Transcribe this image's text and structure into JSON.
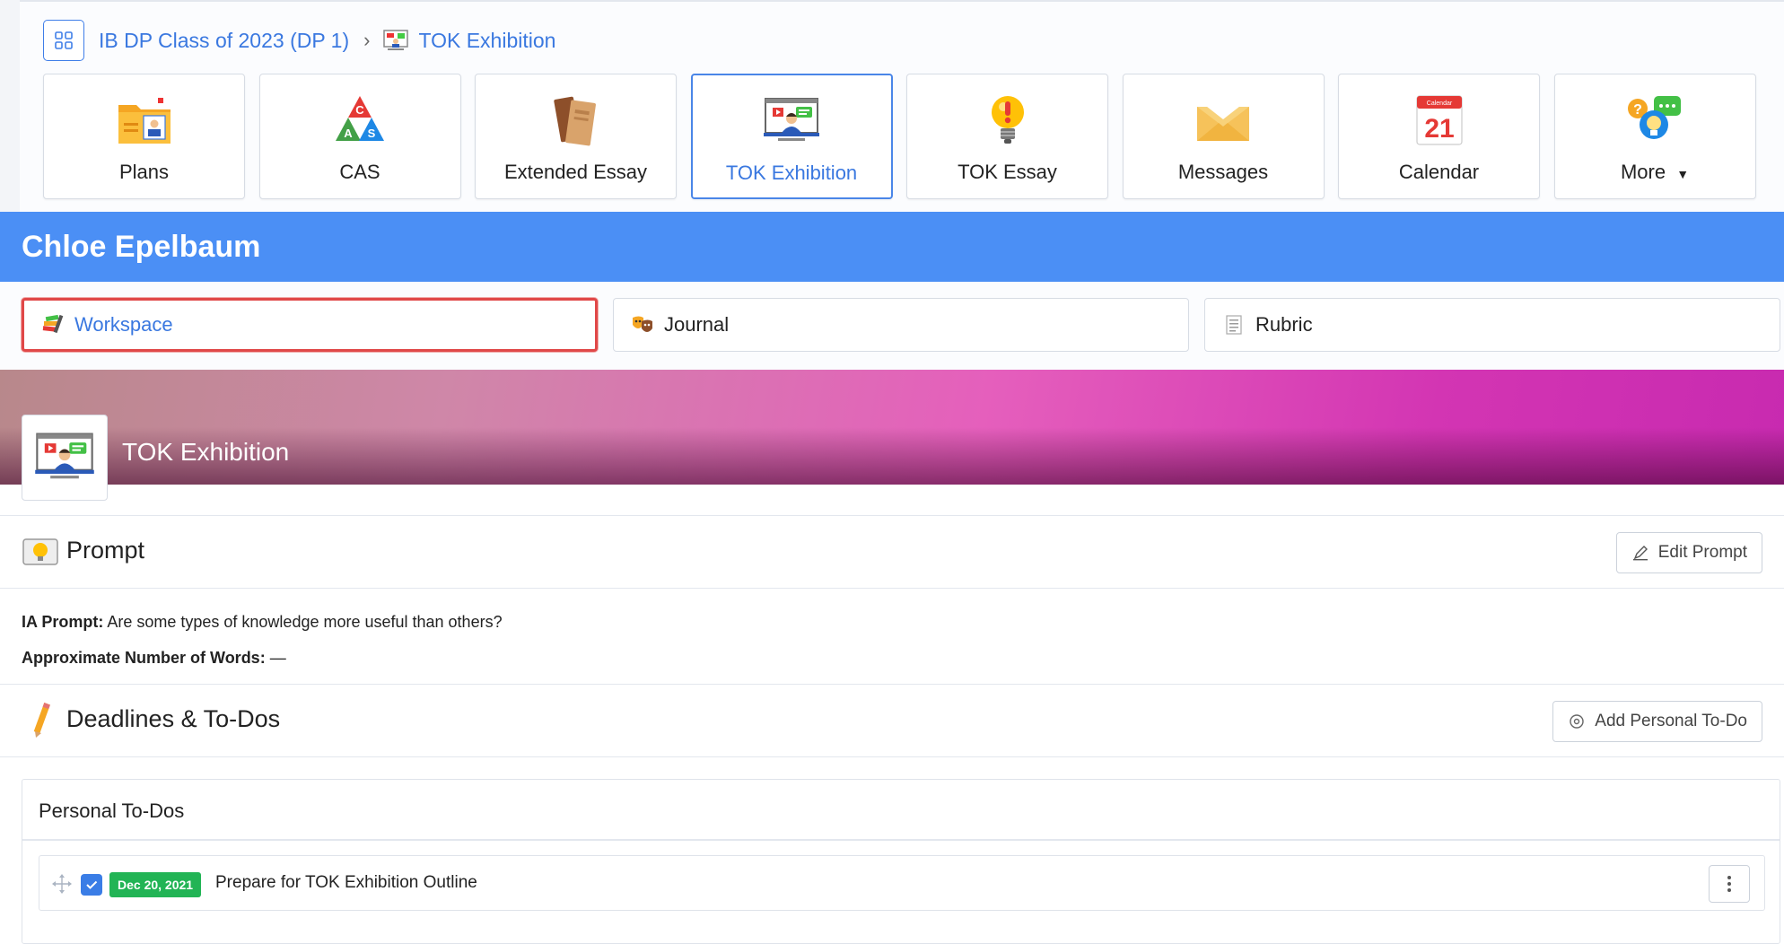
{
  "breadcrumb": {
    "parent": "IB DP Class of 2023 (DP 1)",
    "current": "TOK Exhibition"
  },
  "tiles": [
    {
      "label": "Plans",
      "icon": "plans-folder-icon"
    },
    {
      "label": "CAS",
      "icon": "cas-triangle-icon"
    },
    {
      "label": "Extended Essay",
      "icon": "books-icon"
    },
    {
      "label": "TOK Exhibition",
      "icon": "presentation-screen-icon",
      "active": true
    },
    {
      "label": "TOK Essay",
      "icon": "lightbulb-icon"
    },
    {
      "label": "Messages",
      "icon": "envelope-icon"
    },
    {
      "label": "Calendar",
      "icon": "calendar-icon",
      "calendar_day": "21",
      "calendar_month": "Calendar"
    },
    {
      "label": "More",
      "icon": "chat-bubbles-icon",
      "dropdown": true
    }
  ],
  "student": {
    "name": "Chloe Epelbaum"
  },
  "tabs": [
    {
      "label": "Workspace",
      "icon": "workspace-icon",
      "active": true
    },
    {
      "label": "Journal",
      "icon": "journal-masks-icon"
    },
    {
      "label": "Rubric",
      "icon": "rubric-list-icon"
    }
  ],
  "banner": {
    "title": "TOK Exhibition"
  },
  "prompt_section": {
    "title": "Prompt",
    "edit_button": "Edit Prompt",
    "ia_prompt_label": "IA Prompt:",
    "ia_prompt_value": "Are some types of knowledge more useful than others?",
    "words_label": "Approximate Number of Words:",
    "words_value": "—"
  },
  "deadlines_section": {
    "title": "Deadlines & To-Dos",
    "add_button": "Add Personal To-Do"
  },
  "personal_todos": {
    "title": "Personal To-Dos",
    "items": [
      {
        "date": "Dec 20, 2021",
        "text": "Prepare for TOK Exhibition Outline",
        "checked": true
      }
    ]
  },
  "colors": {
    "accent": "#4b8ff5",
    "link": "#3a78e0",
    "badge_green": "#22b455",
    "highlight_red": "#e04848"
  }
}
